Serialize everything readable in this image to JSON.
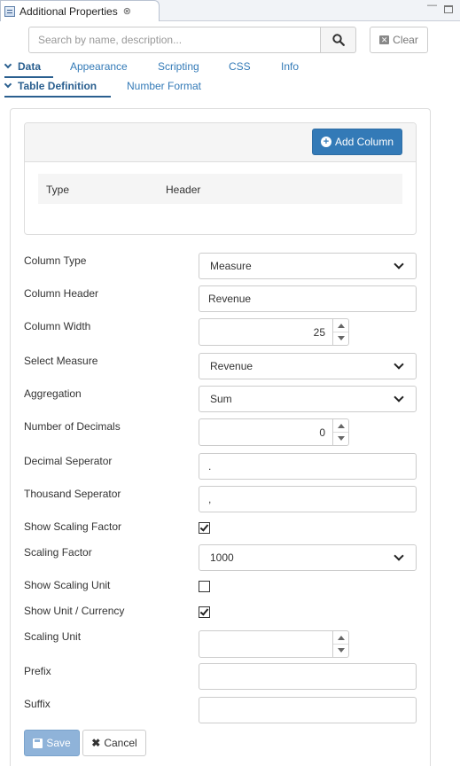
{
  "view": {
    "title": "Additional Properties",
    "close_glyph": "⊗",
    "minimize_glyph": "—"
  },
  "search": {
    "placeholder": "Search by name, description...",
    "value": "",
    "clear_label": "Clear"
  },
  "tabs_primary": [
    {
      "label": "Data",
      "active": true
    },
    {
      "label": "Appearance",
      "active": false
    },
    {
      "label": "Scripting",
      "active": false
    },
    {
      "label": "CSS",
      "active": false
    },
    {
      "label": "Info",
      "active": false
    }
  ],
  "tabs_secondary": [
    {
      "label": "Table Definition",
      "active": true
    },
    {
      "label": "Number Format",
      "active": false
    }
  ],
  "columns": {
    "add_label": "Add Column",
    "headers": [
      "Type",
      "Header"
    ]
  },
  "form": {
    "column_type": {
      "label": "Column Type",
      "value": "Measure"
    },
    "column_header": {
      "label": "Column Header",
      "value": "Revenue"
    },
    "column_width": {
      "label": "Column Width",
      "value": "25"
    },
    "select_measure": {
      "label": "Select Measure",
      "value": "Revenue"
    },
    "aggregation": {
      "label": "Aggregation",
      "value": "Sum"
    },
    "number_of_decimals": {
      "label": "Number of Decimals",
      "value": "0"
    },
    "decimal_separator": {
      "label": "Decimal Seperator",
      "value": "."
    },
    "thousand_separator": {
      "label": "Thousand Seperator",
      "value": ","
    },
    "show_scaling_factor": {
      "label": "Show Scaling Factor",
      "checked": true
    },
    "scaling_factor": {
      "label": "Scaling Factor",
      "value": "1000"
    },
    "show_scaling_unit": {
      "label": "Show Scaling Unit",
      "checked": false
    },
    "show_unit_currency": {
      "label": "Show Unit / Currency",
      "checked": true
    },
    "scaling_unit": {
      "label": "Scaling Unit",
      "value": ""
    },
    "prefix": {
      "label": "Prefix",
      "value": ""
    },
    "suffix": {
      "label": "Suffix",
      "value": ""
    }
  },
  "actions": {
    "save_label": "Save",
    "cancel_label": "Cancel"
  },
  "colors": {
    "primary": "#337ab7",
    "link": "#337ab7",
    "active_tab": "#2a5f8f",
    "save_disabled": "#8fb3d9"
  }
}
